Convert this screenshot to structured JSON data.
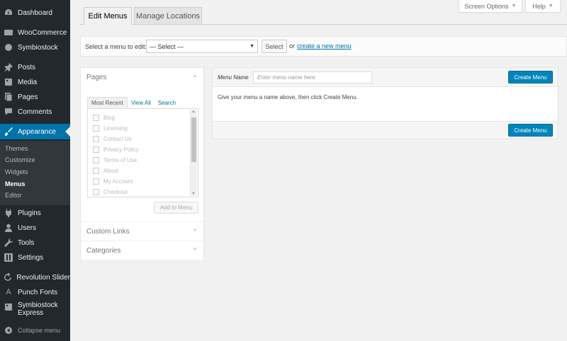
{
  "sidebar": {
    "items": [
      {
        "label": "Dashboard",
        "icon": "dashboard-icon"
      },
      {
        "label": "WooCommerce",
        "icon": "woocommerce-icon"
      },
      {
        "label": "Symbiostock",
        "icon": "symbiostock-icon"
      },
      {
        "label": "Posts",
        "icon": "pin-icon"
      },
      {
        "label": "Media",
        "icon": "media-icon"
      },
      {
        "label": "Pages",
        "icon": "pages-icon"
      },
      {
        "label": "Comments",
        "icon": "comment-icon"
      },
      {
        "label": "Appearance",
        "icon": "paintbrush-icon"
      },
      {
        "label": "Plugins",
        "icon": "plugin-icon"
      },
      {
        "label": "Users",
        "icon": "users-icon"
      },
      {
        "label": "Tools",
        "icon": "wrench-icon"
      },
      {
        "label": "Settings",
        "icon": "settings-icon"
      },
      {
        "label": "Revolution Slider",
        "icon": "refresh-icon"
      },
      {
        "label": "Punch Fonts",
        "icon": "font-icon"
      },
      {
        "label": "Symbiostock",
        "label2": "Express",
        "icon": "symbiostock-express-icon"
      },
      {
        "label": "Collapse menu",
        "icon": "collapse-icon"
      }
    ],
    "submenu": [
      "Themes",
      "Customize",
      "Widgets",
      "Menus",
      "Editor"
    ]
  },
  "tabs": {
    "edit_menus": "Edit Menus",
    "manage_locations": "Manage Locations"
  },
  "top_links": {
    "screen_options": "Screen Options",
    "help": "Help"
  },
  "select_bar": {
    "label": "Select a menu to edit:",
    "selected": "— Select —",
    "select_button": "Select",
    "or": "or",
    "create_link": "create a new menu"
  },
  "accordion": {
    "pages_title": "Pages",
    "subtabs": [
      "Most Recent",
      "View All",
      "Search"
    ],
    "pages": [
      "Blog",
      "Licensing",
      "Contact Us",
      "Privacy Policy",
      "Terms of Use",
      "About",
      "My Account",
      "Checkout"
    ],
    "add_button": "Add to Menu",
    "custom_links": "Custom Links",
    "categories": "Categories"
  },
  "editor": {
    "menu_name_label": "Menu Name",
    "menu_name_placeholder": "Enter menu name here",
    "create_button": "Create Menu",
    "instructions": "Give your menu a name above, then click Create Menu."
  },
  "colors": {
    "sidebar_bg": "#23282d",
    "active_blue": "#0073aa",
    "primary_button": "#0085ba"
  }
}
